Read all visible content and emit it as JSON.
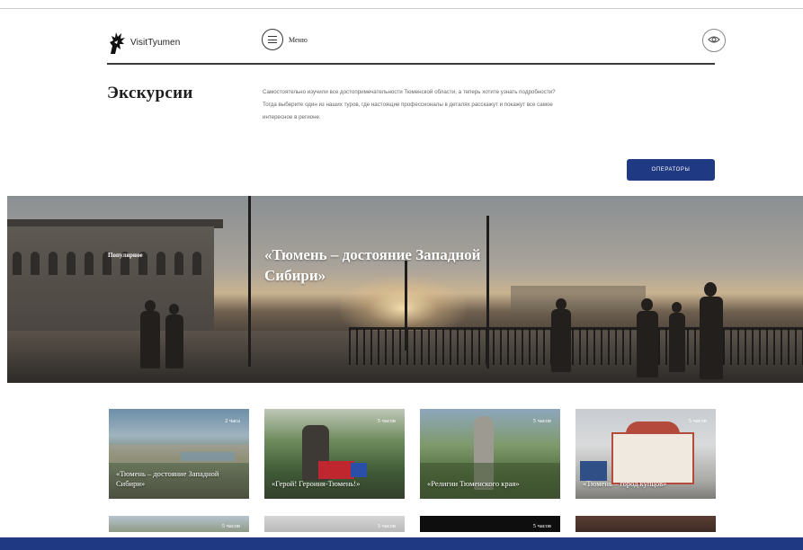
{
  "brand": {
    "name": "VisitTyumen"
  },
  "header": {
    "menu_label": "Меню",
    "icons": {
      "logo": "dragon-logo-icon",
      "menu": "menu-lines-icon",
      "accessibility": "eye-icon"
    }
  },
  "intro": {
    "title": "Экскурсии",
    "text": "Самостоятельно изучили все достопримечательности Тюменской области, а теперь хотите узнать подробности? Тогда выберите один из наших туров, где настоящие профессионалы в деталях расскажут и покажут все самое интересное в регионе.",
    "operators_button": "ОПЕРАТОРЫ"
  },
  "hero": {
    "badge": "Популярное",
    "title": "«Тюмень – достояние Западной Сибири»"
  },
  "cards": [
    {
      "duration": "2 часа",
      "title": "«Тюмень – достояние Западной Сибири»"
    },
    {
      "duration": "5 часов",
      "title": "«Герой! Героиня-Тюмень!»"
    },
    {
      "duration": "5 часов",
      "title": "«Религии Тюменского края»"
    },
    {
      "duration": "5 часов",
      "title": "«Тюмень – город купцов»"
    }
  ],
  "cards_row2": [
    {
      "duration": "5 часов"
    },
    {
      "duration": "5 часов"
    },
    {
      "duration": "5 часов"
    },
    {
      "duration": ""
    }
  ],
  "colors": {
    "accent": "#1f3a82",
    "text": "#2c2c2c",
    "muted": "#666666"
  }
}
